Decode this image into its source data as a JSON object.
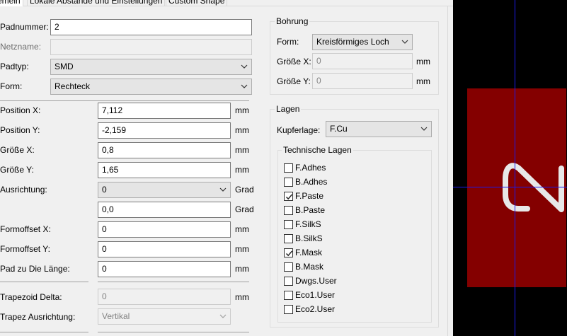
{
  "tabs": [
    {
      "label": "Allgemein",
      "visible": "emein",
      "active": true
    },
    {
      "label": "Lokale Abstände und Einstellungen",
      "active": false
    },
    {
      "label": "Custom Shape",
      "active": false
    }
  ],
  "left": {
    "padnummer": {
      "label": "Padnummer:",
      "value": "2"
    },
    "netzname": {
      "label": "Netzname:",
      "value": ""
    },
    "padtyp": {
      "label": "Padtyp:",
      "value": "SMD"
    },
    "form": {
      "label": "Form:",
      "value": "Rechteck"
    },
    "position_x": {
      "label": "Position X:",
      "value": "7,112",
      "unit": "mm"
    },
    "position_y": {
      "label": "Position Y:",
      "value": "-2,159",
      "unit": "mm"
    },
    "groesse_x": {
      "label": "Größe X:",
      "value": "0,8",
      "unit": "mm"
    },
    "groesse_y": {
      "label": "Größe Y:",
      "value": "1,65",
      "unit": "mm"
    },
    "ausrichtung": {
      "label": "Ausrichtung:",
      "value": "0",
      "unit": "Grad"
    },
    "ausrichtung_custom": {
      "value": "0,0",
      "unit": "Grad"
    },
    "formoffset_x": {
      "label": "Formoffset X:",
      "value": "0",
      "unit": "mm"
    },
    "formoffset_y": {
      "label": "Formoffset Y:",
      "value": "0",
      "unit": "mm"
    },
    "pad_laenge": {
      "label": "Pad zu Die Länge:",
      "value": "0",
      "unit": "mm"
    },
    "trapezoid_delta": {
      "label": "Trapezoid Delta:",
      "value": "0",
      "unit": "mm"
    },
    "trapez_ausrichtung": {
      "label": "Trapez Ausrichtung:",
      "value": "Vertikal"
    }
  },
  "bohrung": {
    "title": "Bohrung",
    "form": {
      "label": "Form:",
      "value": "Kreisförmiges Loch"
    },
    "groesse_x": {
      "label": "Größe X:",
      "value": "0",
      "unit": "mm"
    },
    "groesse_y": {
      "label": "Größe Y:",
      "value": "0",
      "unit": "mm"
    }
  },
  "lagen": {
    "title": "Lagen",
    "kupferlage": {
      "label": "Kupferlage:",
      "value": "F.Cu"
    },
    "technische_title": "Technische Lagen",
    "layers": [
      {
        "label": "F.Adhes",
        "checked": false
      },
      {
        "label": "B.Adhes",
        "checked": false
      },
      {
        "label": "F.Paste",
        "checked": true
      },
      {
        "label": "B.Paste",
        "checked": false
      },
      {
        "label": "F.SilkS",
        "checked": false
      },
      {
        "label": "B.SilkS",
        "checked": false
      },
      {
        "label": "F.Mask",
        "checked": true
      },
      {
        "label": "B.Mask",
        "checked": false
      },
      {
        "label": "Dwgs.User",
        "checked": false
      },
      {
        "label": "Eco1.User",
        "checked": false
      },
      {
        "label": "Eco2.User",
        "checked": false
      }
    ]
  },
  "preview": {
    "pad_color": "#840000",
    "crosshair_color": "#1a1af0",
    "pad_number": "2"
  }
}
